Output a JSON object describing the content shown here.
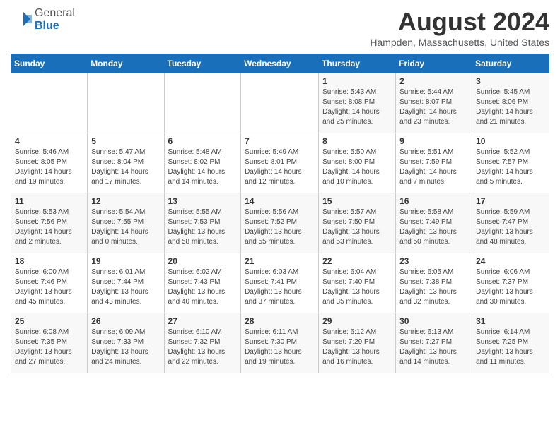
{
  "logo": {
    "general": "General",
    "blue": "Blue"
  },
  "header": {
    "month_year": "August 2024",
    "location": "Hampden, Massachusetts, United States"
  },
  "weekdays": [
    "Sunday",
    "Monday",
    "Tuesday",
    "Wednesday",
    "Thursday",
    "Friday",
    "Saturday"
  ],
  "weeks": [
    [
      {
        "day": "",
        "info": ""
      },
      {
        "day": "",
        "info": ""
      },
      {
        "day": "",
        "info": ""
      },
      {
        "day": "",
        "info": ""
      },
      {
        "day": "1",
        "info": "Sunrise: 5:43 AM\nSunset: 8:08 PM\nDaylight: 14 hours\nand 25 minutes."
      },
      {
        "day": "2",
        "info": "Sunrise: 5:44 AM\nSunset: 8:07 PM\nDaylight: 14 hours\nand 23 minutes."
      },
      {
        "day": "3",
        "info": "Sunrise: 5:45 AM\nSunset: 8:06 PM\nDaylight: 14 hours\nand 21 minutes."
      }
    ],
    [
      {
        "day": "4",
        "info": "Sunrise: 5:46 AM\nSunset: 8:05 PM\nDaylight: 14 hours\nand 19 minutes."
      },
      {
        "day": "5",
        "info": "Sunrise: 5:47 AM\nSunset: 8:04 PM\nDaylight: 14 hours\nand 17 minutes."
      },
      {
        "day": "6",
        "info": "Sunrise: 5:48 AM\nSunset: 8:02 PM\nDaylight: 14 hours\nand 14 minutes."
      },
      {
        "day": "7",
        "info": "Sunrise: 5:49 AM\nSunset: 8:01 PM\nDaylight: 14 hours\nand 12 minutes."
      },
      {
        "day": "8",
        "info": "Sunrise: 5:50 AM\nSunset: 8:00 PM\nDaylight: 14 hours\nand 10 minutes."
      },
      {
        "day": "9",
        "info": "Sunrise: 5:51 AM\nSunset: 7:59 PM\nDaylight: 14 hours\nand 7 minutes."
      },
      {
        "day": "10",
        "info": "Sunrise: 5:52 AM\nSunset: 7:57 PM\nDaylight: 14 hours\nand 5 minutes."
      }
    ],
    [
      {
        "day": "11",
        "info": "Sunrise: 5:53 AM\nSunset: 7:56 PM\nDaylight: 14 hours\nand 2 minutes."
      },
      {
        "day": "12",
        "info": "Sunrise: 5:54 AM\nSunset: 7:55 PM\nDaylight: 14 hours\nand 0 minutes."
      },
      {
        "day": "13",
        "info": "Sunrise: 5:55 AM\nSunset: 7:53 PM\nDaylight: 13 hours\nand 58 minutes."
      },
      {
        "day": "14",
        "info": "Sunrise: 5:56 AM\nSunset: 7:52 PM\nDaylight: 13 hours\nand 55 minutes."
      },
      {
        "day": "15",
        "info": "Sunrise: 5:57 AM\nSunset: 7:50 PM\nDaylight: 13 hours\nand 53 minutes."
      },
      {
        "day": "16",
        "info": "Sunrise: 5:58 AM\nSunset: 7:49 PM\nDaylight: 13 hours\nand 50 minutes."
      },
      {
        "day": "17",
        "info": "Sunrise: 5:59 AM\nSunset: 7:47 PM\nDaylight: 13 hours\nand 48 minutes."
      }
    ],
    [
      {
        "day": "18",
        "info": "Sunrise: 6:00 AM\nSunset: 7:46 PM\nDaylight: 13 hours\nand 45 minutes."
      },
      {
        "day": "19",
        "info": "Sunrise: 6:01 AM\nSunset: 7:44 PM\nDaylight: 13 hours\nand 43 minutes."
      },
      {
        "day": "20",
        "info": "Sunrise: 6:02 AM\nSunset: 7:43 PM\nDaylight: 13 hours\nand 40 minutes."
      },
      {
        "day": "21",
        "info": "Sunrise: 6:03 AM\nSunset: 7:41 PM\nDaylight: 13 hours\nand 37 minutes."
      },
      {
        "day": "22",
        "info": "Sunrise: 6:04 AM\nSunset: 7:40 PM\nDaylight: 13 hours\nand 35 minutes."
      },
      {
        "day": "23",
        "info": "Sunrise: 6:05 AM\nSunset: 7:38 PM\nDaylight: 13 hours\nand 32 minutes."
      },
      {
        "day": "24",
        "info": "Sunrise: 6:06 AM\nSunset: 7:37 PM\nDaylight: 13 hours\nand 30 minutes."
      }
    ],
    [
      {
        "day": "25",
        "info": "Sunrise: 6:08 AM\nSunset: 7:35 PM\nDaylight: 13 hours\nand 27 minutes."
      },
      {
        "day": "26",
        "info": "Sunrise: 6:09 AM\nSunset: 7:33 PM\nDaylight: 13 hours\nand 24 minutes."
      },
      {
        "day": "27",
        "info": "Sunrise: 6:10 AM\nSunset: 7:32 PM\nDaylight: 13 hours\nand 22 minutes."
      },
      {
        "day": "28",
        "info": "Sunrise: 6:11 AM\nSunset: 7:30 PM\nDaylight: 13 hours\nand 19 minutes."
      },
      {
        "day": "29",
        "info": "Sunrise: 6:12 AM\nSunset: 7:29 PM\nDaylight: 13 hours\nand 16 minutes."
      },
      {
        "day": "30",
        "info": "Sunrise: 6:13 AM\nSunset: 7:27 PM\nDaylight: 13 hours\nand 14 minutes."
      },
      {
        "day": "31",
        "info": "Sunrise: 6:14 AM\nSunset: 7:25 PM\nDaylight: 13 hours\nand 11 minutes."
      }
    ]
  ]
}
